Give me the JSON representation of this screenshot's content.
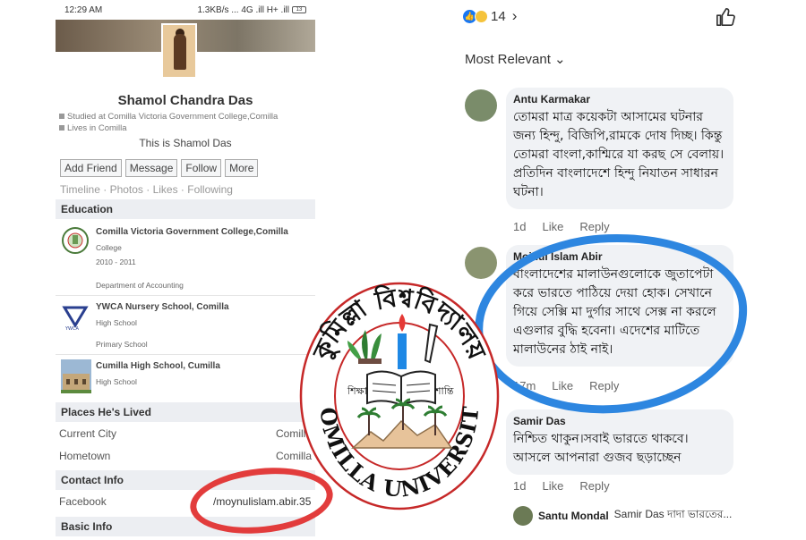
{
  "status_bar": {
    "time": "12:29 AM",
    "network": "1.3KB/s ... 4G .ill H+ .ill",
    "battery": "13"
  },
  "profile": {
    "name": "Shamol Chandra Das",
    "studied": "Studied at Comilla Victoria Government College,Comilla",
    "lives": "Lives in Comilla",
    "bio": "This is Shamol Das",
    "buttons": [
      "Add Friend",
      "Message",
      "Follow",
      "More"
    ],
    "tabs": "Timeline · Photos · Likes · Following"
  },
  "education": {
    "header": "Education",
    "items": [
      {
        "title": "Comilla Victoria Government College,Comilla",
        "sub1": "College",
        "sub2": "2010 - 2011",
        "sub3": "Department of Accounting"
      },
      {
        "title": "YWCA Nursery School, Comilla",
        "sub1": "High School",
        "sub2": "Primary School"
      },
      {
        "title": "Cumilla High School, Cumilla",
        "sub1": "High School"
      }
    ]
  },
  "places": {
    "header": "Places He's Lived",
    "current_label": "Current City",
    "current_value": "Comilla",
    "home_label": "Hometown",
    "home_value": "Comilla"
  },
  "contact": {
    "header": "Contact Info",
    "facebook_label": "Facebook",
    "facebook_value": "/moynulislam.abir.35"
  },
  "basic": {
    "header": "Basic Info"
  },
  "comments_panel": {
    "reaction_count": "14",
    "sort_label": "Most Relevant",
    "comments": [
      {
        "name": "Antu Karmakar",
        "text": "তোমরা মাত্র কয়েকটা আসামের ঘটনার জন্য হিন্দু, বিজিপি,রামকে দোষ দিচ্ছ। কিন্তু তোমরা বাংলা,কাশ্মিরে যা করছ সে বেলায়। প্রতিদিন বাংলাদেশে হিন্দু নিযাতন সাধারন ঘটনা।",
        "time": "1d",
        "like": "Like",
        "reply": "Reply"
      },
      {
        "name": "Moinul Islam Abir",
        "text": "বাংলাদেশের মালাউনগুলোকে জুতাপেটা করে ভারতে পাঠিয়ে দেয়া হোক। সেখানে গিয়ে সেক্সি মা দুর্গার সাথে সেক্স না করলে এগুলার বুদ্ধি হবেনা। এদেশের মাটিতে মালাউনের ঠাই নাই।",
        "time": "17m",
        "like": "Like",
        "reply": "Reply"
      },
      {
        "name": "Samir Das",
        "text": "নিশ্চিত থাকুন।সবাই ভারতে থাকবে।আসলে আপনারা গুজব ছড়াচ্ছেন",
        "time": "1d",
        "like": "Like",
        "reply": "Reply"
      }
    ],
    "last_reply": {
      "name": "Santu Mondal",
      "preview": "Samir Das দাদা ভারতের..."
    }
  },
  "seal": {
    "top_text": "কুমিল্লা বিশ্ববিদ্যালয়",
    "left_word": "শিক্ষা",
    "right_word": "শান্তি",
    "bottom_text": "COMILLA UNIVERSITY"
  },
  "colors": {
    "facebook_blue": "#1877f2",
    "annotation_red": "#e23c3c",
    "annotation_blue": "#2d86e0",
    "seal_red": "#c62828"
  }
}
